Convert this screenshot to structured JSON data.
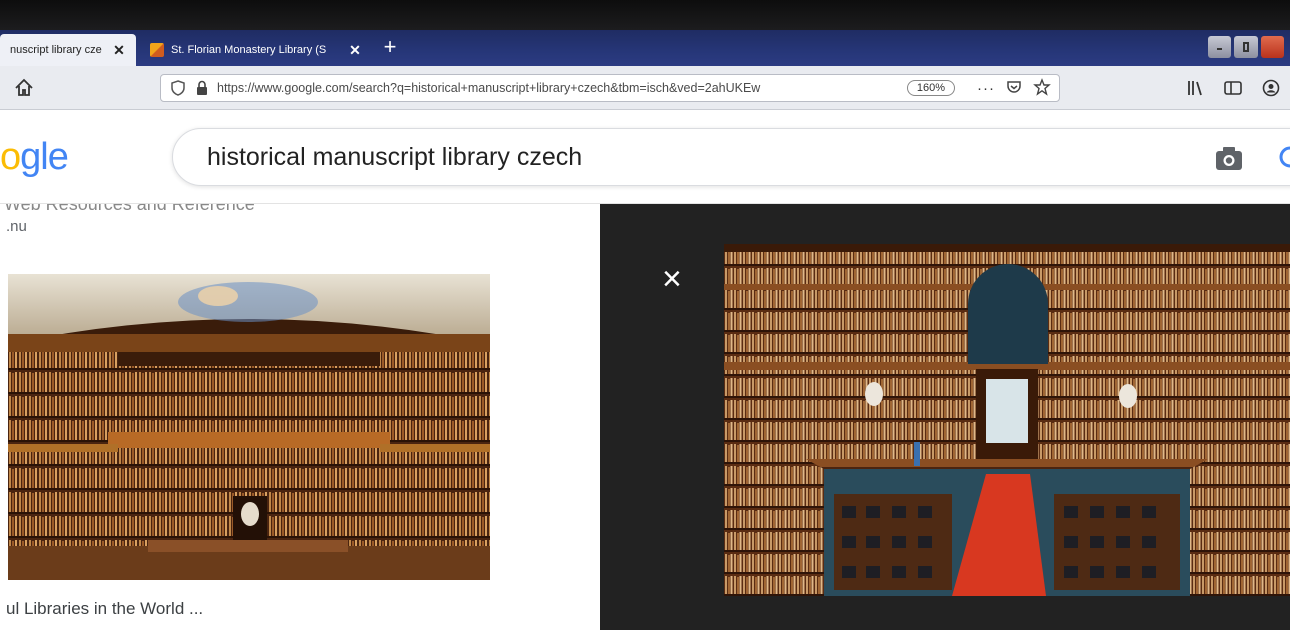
{
  "browser": {
    "tabs": [
      {
        "title": "nuscript library cze",
        "close": "✕",
        "active": true
      },
      {
        "title": "St. Florian Monastery Library (S",
        "close": "✕",
        "active": false
      }
    ],
    "new_tab": "+",
    "url": "https://www.google.com/search?q=historical+manuscript+library+czech&tbm=isch&ved=2ahUKEw",
    "zoom": "160%",
    "menu_dots": "···"
  },
  "google": {
    "logo_visible": "gle",
    "logo_partial": "o",
    "query": "historical manuscript library czech"
  },
  "results": {
    "cutoff_text": "Web Resources and Reference",
    "domain": ".nu",
    "caption": "ul Libraries in the World ..."
  },
  "preview": {
    "close": "×"
  },
  "colors": {
    "tab_strip": "#263678",
    "google_blue": "#4285f4",
    "google_red": "#ea4335",
    "google_yellow": "#fbbc05",
    "google_green": "#34a853"
  }
}
